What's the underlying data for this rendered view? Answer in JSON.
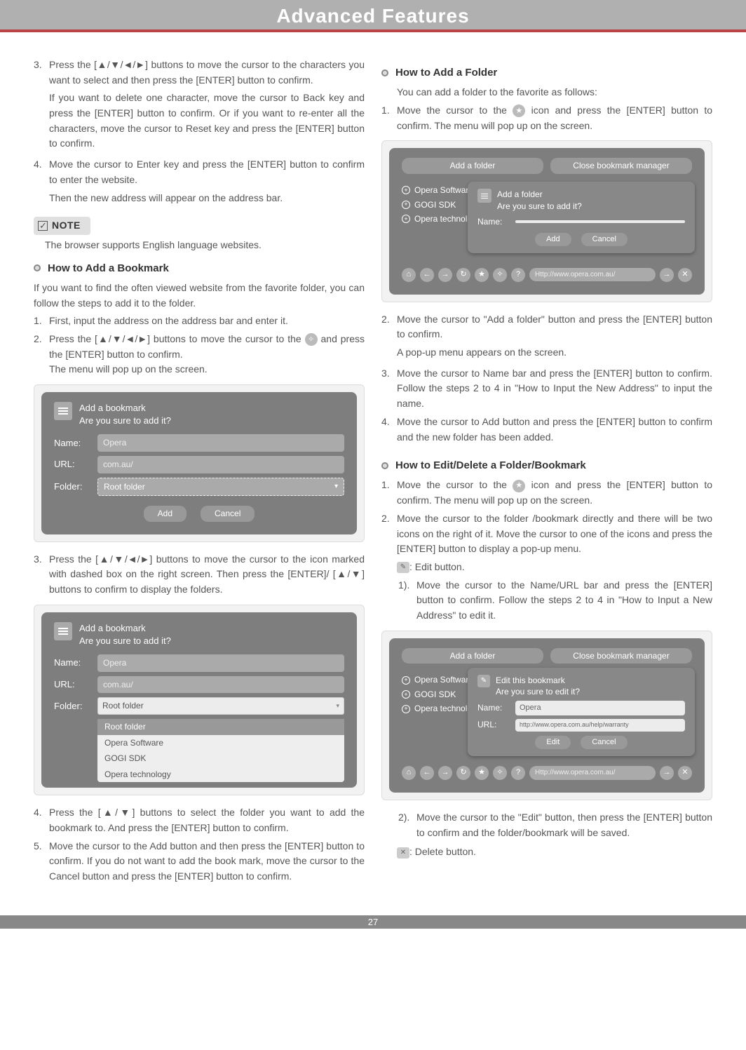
{
  "header": {
    "title": "Advanced Features"
  },
  "pageNumber": "27",
  "left": {
    "s3": {
      "num": "3.",
      "p1": "Press the [▲/▼/◄/►] buttons to move the cursor to the characters you want to select and then press the [ENTER] button to confirm.",
      "p2": "If you want to delete one character, move the cursor to Back key and press the [ENTER] button to confirm. Or if you want to re-enter all the characters, move the cursor to Reset key and press the [ENTER] button to confirm."
    },
    "s4": {
      "num": "4.",
      "p1": "Move the cursor to Enter key and press the [ENTER] button to confirm to enter the website.",
      "p2": "Then the new address will appear on the address bar."
    },
    "note": {
      "label": "NOTE",
      "text": "The browser supports English language websites."
    },
    "bookmark": {
      "heading": "How to Add a Bookmark",
      "intro": "If you want to find the often viewed website from the favorite folder, you can follow the steps to add it to the folder.",
      "s1": {
        "num": "1.",
        "t": "First, input the address on the address bar and enter it."
      },
      "s2": {
        "num": "2.",
        "t1": "Press the [▲/▼/◄/►] buttons to move the cursor to the",
        "t2": "and press the [ENTER] button to confirm.",
        "t3": "The menu will pop up on the screen."
      },
      "dlg1": {
        "title1": "Add a bookmark",
        "title2": "Are you sure to add it?",
        "nameLabel": "Name:",
        "nameVal": "Opera",
        "urlLabel": "URL:",
        "urlVal": "com.au/",
        "folderLabel": "Folder:",
        "folderVal": "Root folder",
        "add": "Add",
        "cancel": "Cancel"
      },
      "s3b": {
        "num": "3.",
        "t": "Press the [▲/▼/◄/►] buttons to move the cursor to the icon marked with dashed box on the right screen. Then press the [ENTER]/ [▲/▼] buttons to confirm to display the folders."
      },
      "dlg2": {
        "title1": "Add a bookmark",
        "title2": "Are you sure to add it?",
        "nameLabel": "Name:",
        "nameVal": "Opera",
        "urlLabel": "URL:",
        "urlVal": "com.au/",
        "folderLabel": "Folder:",
        "folderVal": "Root folder",
        "opts": [
          "Root folder",
          "Opera Software",
          "GOGI SDK",
          "Opera technology"
        ]
      },
      "s4b": {
        "num": "4.",
        "t": "Press the [▲/▼] buttons to select the folder you want to add the bookmark to. And press the [ENTER] button to confirm."
      },
      "s5": {
        "num": "5.",
        "t": "Move the cursor to the Add button and then press the [ENTER] button to confirm. If you do not want to add the book mark, move the cursor to the Cancel button and press the [ENTER] button to confirm."
      }
    }
  },
  "right": {
    "folder": {
      "heading": "How to Add a Folder",
      "intro": "You can add a folder to the favorite as follows:",
      "s1": {
        "num": "1.",
        "t": "Move the cursor to the ",
        "t2": " icon and press the [ENTER] button to confirm. The menu will pop up on the screen."
      },
      "dlg": {
        "tab1": "Add a folder",
        "tab2": "Close bookmark manager",
        "tree": [
          "Opera Software",
          "GOGI SDK",
          "Opera technolo"
        ],
        "popupTitle1": "Add a folder",
        "popupTitle2": "Are you sure to add it?",
        "nameLabel": "Name:",
        "add": "Add",
        "cancel": "Cancel",
        "url": "Http://www.opera.com.au/"
      },
      "s2": {
        "num": "2.",
        "t1": "Move the cursor to \"Add a folder\" button and press the [ENTER] button to confirm.",
        "t2": "A pop-up menu appears on the screen."
      },
      "s3": {
        "num": "3.",
        "t": "Move the cursor to Name bar and press the [ENTER] button to confirm. Follow the steps 2 to 4 in \"How to Input the New Address\" to input the name."
      },
      "s4": {
        "num": "4.",
        "t": "Move the cursor to Add button and press the [ENTER] button to confirm and the new folder has been added."
      }
    },
    "edit": {
      "heading": "How to Edit/Delete a Folder/Bookmark",
      "s1": {
        "num": "1.",
        "t": "Move the cursor to the ",
        "t2": " icon and press the [ENTER] button to confirm. The menu will pop up on the screen."
      },
      "s2": {
        "num": "2.",
        "t": "Move the cursor to the folder /bookmark directly and there will be two icons on the right of it. Move the cursor to one of the icons and press the [ENTER] button to display a pop-up menu."
      },
      "editBtn": ": Edit button.",
      "sub1": {
        "num": "1).",
        "t": "Move the cursor to the Name/URL bar and press the [ENTER] button to confirm. Follow the steps 2 to 4 in \"How to Input a New Address\" to edit it."
      },
      "dlg": {
        "tab1": "Add a folder",
        "tab2": "Close bookmark manager",
        "tree": [
          "Opera Software",
          "GOGI SDK",
          "Opera technolo"
        ],
        "popupTitle1": "Edit this bookmark",
        "popupTitle2": "Are you sure to edit it?",
        "nameLabel": "Name:",
        "nameVal": "Opera",
        "urlLabel": "URL:",
        "urlVal": "http://www.opera.com.au/help/warranty",
        "edit": "Edit",
        "cancel": "Cancel",
        "url": "Http://www.opera.com.au/"
      },
      "sub2": {
        "num": "2).",
        "t": "Move the cursor to the \"Edit\" button, then press the [ENTER] button to confirm and the folder/bookmark will be saved."
      },
      "deleteBtn": ": Delete button."
    }
  }
}
